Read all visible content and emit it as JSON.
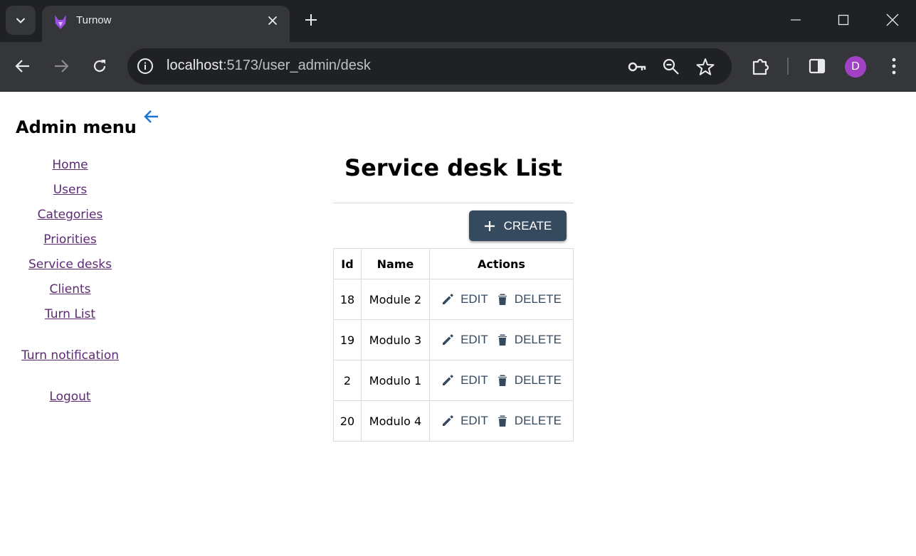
{
  "browser": {
    "tab_title": "Turnow",
    "url_host": "localhost",
    "url_path": ":5173/user_admin/desk",
    "profile_initial": "D",
    "brand_purple": "#a142c4"
  },
  "sidebar": {
    "title": "Admin menu",
    "items": [
      {
        "label": "Home"
      },
      {
        "label": "Users"
      },
      {
        "label": "Categories"
      },
      {
        "label": "Priorities"
      },
      {
        "label": "Service desks"
      },
      {
        "label": "Clients"
      },
      {
        "label": "Turn List"
      },
      {
        "label": "Turn notification"
      },
      {
        "label": "Logout"
      }
    ]
  },
  "main": {
    "title": "Service desk List",
    "create_label": "CREATE",
    "table": {
      "headers": [
        "Id",
        "Name",
        "Actions"
      ],
      "edit_label": "EDIT",
      "delete_label": "DELETE",
      "rows": [
        {
          "id": "18",
          "name": "Module 2"
        },
        {
          "id": "19",
          "name": "Modulo 3"
        },
        {
          "id": "2",
          "name": "Modulo 1"
        },
        {
          "id": "20",
          "name": "Modulo 4"
        }
      ]
    }
  },
  "colors": {
    "button_bg": "#354a5f",
    "link": "#5c2a73",
    "back_arrow": "#1976d2"
  }
}
